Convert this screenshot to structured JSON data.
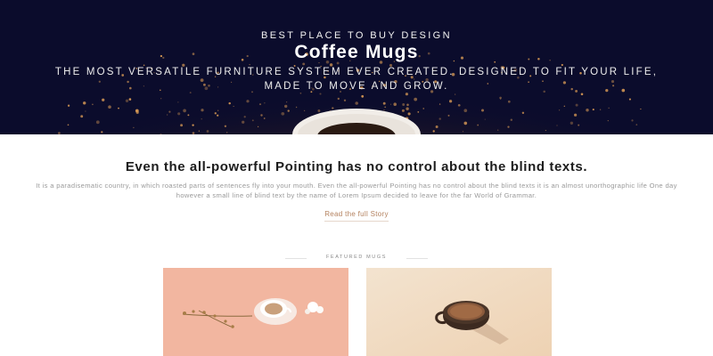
{
  "hero": {
    "eyebrow": "BEST PLACE TO BUY DESIGN",
    "title": "Coffee Mugs",
    "subtitle": "THE MOST VERSATILE FURNITURE SYSTEM EVER CREATED. DESIGNED TO FIT YOUR LIFE, MADE TO MOVE AND GROW."
  },
  "story": {
    "title": "Even the all-powerful Pointing has no control about the blind texts.",
    "body": "It is a paradisematic country, in which roasted parts of sentences fly into your mouth. Even the all-powerful Pointing has no control about the blind texts it is an almost unorthographic life One day however a small line of blind text by the name of Lorem Ipsum decided to leave for the far World of Grammar.",
    "link_label": "Read the full Story"
  },
  "featured": {
    "label": "FEATURED MUGS"
  },
  "colors": {
    "hero_background": "#0b0c2c",
    "accent": "#b4825f",
    "card1_background": "#f2b6a0",
    "card2_background": "#f0dcc4"
  }
}
